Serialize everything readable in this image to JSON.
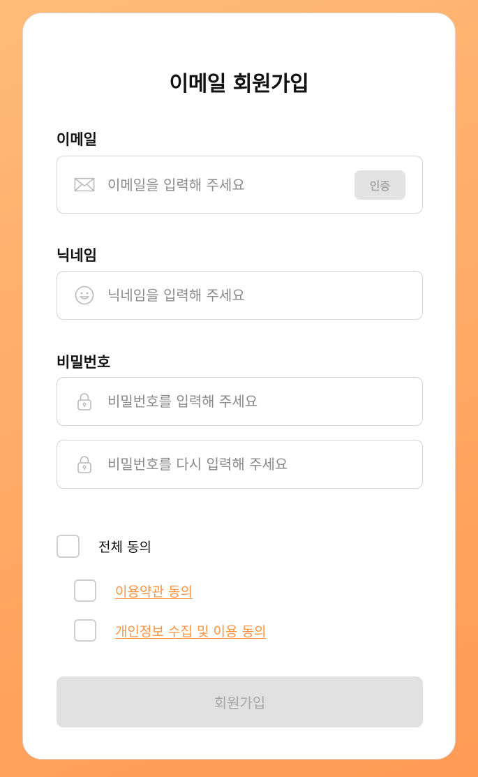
{
  "title": "이메일 회원가입",
  "email": {
    "label": "이메일",
    "placeholder": "이메일을 입력해 주세요",
    "verify_label": "인증",
    "icon": "mail-icon"
  },
  "nickname": {
    "label": "닉네임",
    "placeholder": "닉네임을 입력해 주세요",
    "icon": "smiley-icon"
  },
  "password": {
    "label": "비밀번호",
    "placeholder": "비밀번호를 입력해 주세요",
    "confirm_placeholder": "비밀번호를 다시 입력해 주세요",
    "icon": "lock-icon"
  },
  "agreements": {
    "all": "전체 동의",
    "terms": "이용약관 동의",
    "privacy": "개인정보 수집 및 이용 동의"
  },
  "submit_label": "회원가입",
  "colors": {
    "background": "#ffaa66",
    "accent_link": "#ff9340",
    "disabled_button": "#e1e1e1"
  }
}
